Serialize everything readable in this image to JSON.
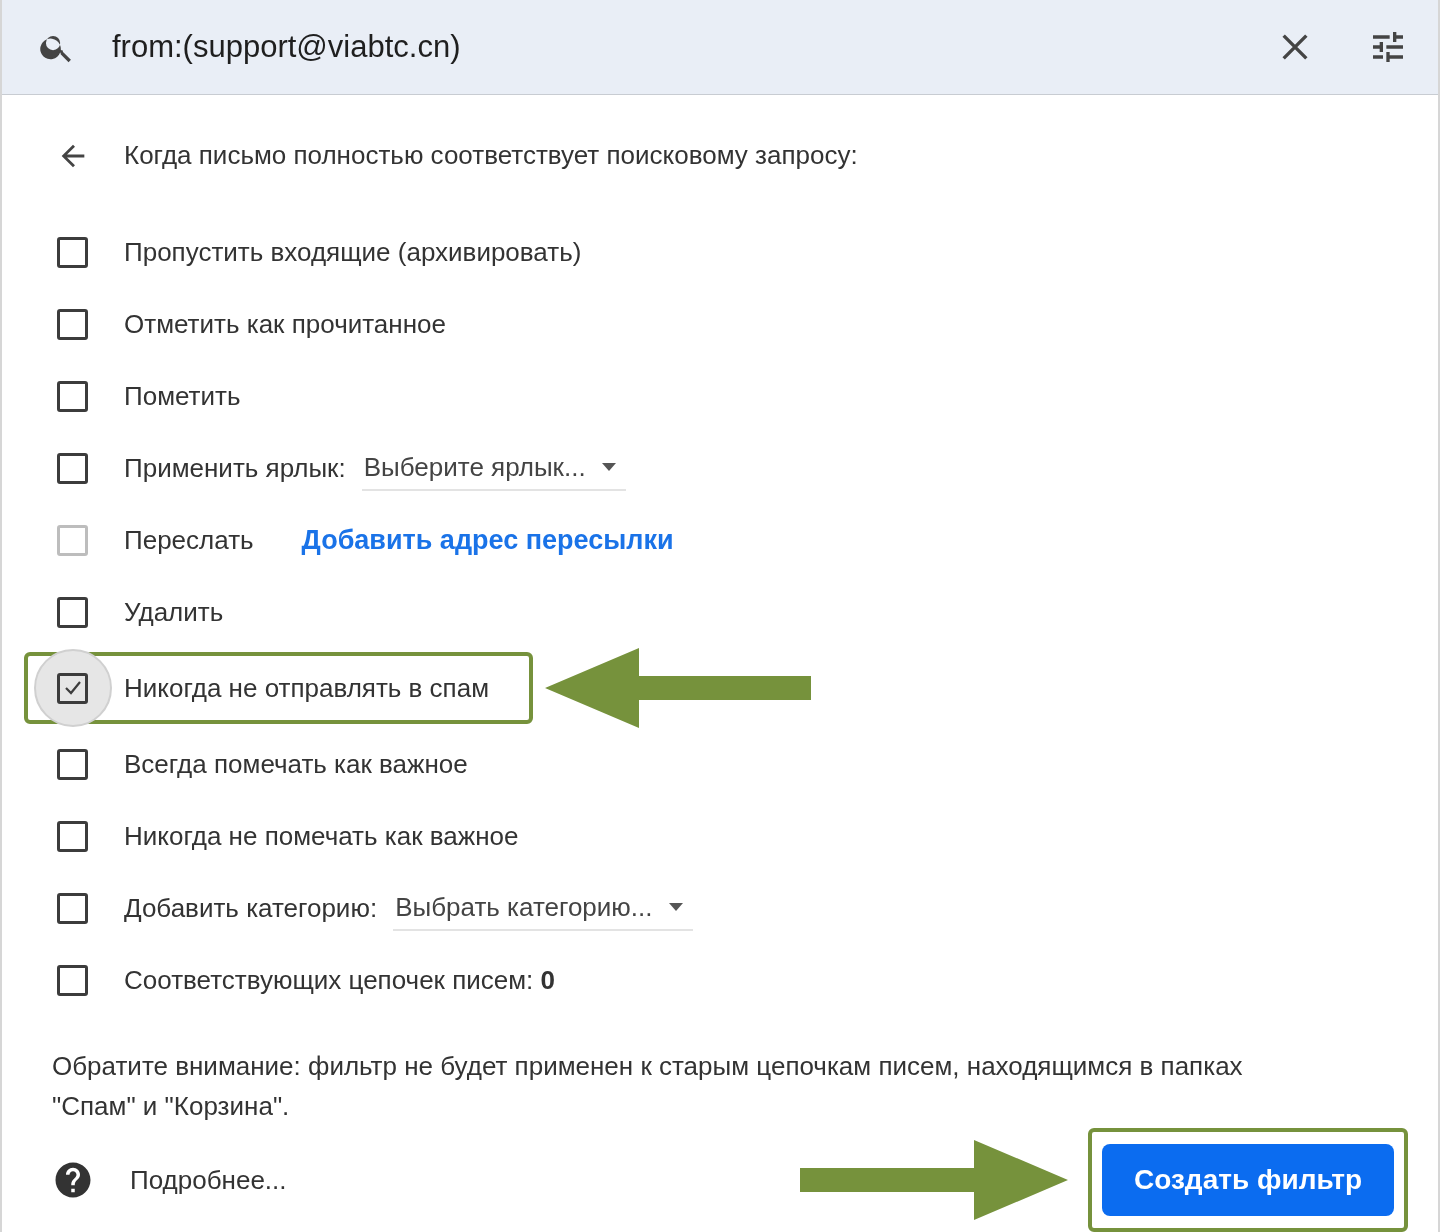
{
  "search": {
    "value": "from:(support@viabtc.cn)"
  },
  "heading": "Когда письмо полностью соответствует поисковому запросу:",
  "options": [
    {
      "kind": "plain",
      "label": "Пропустить входящие (архивировать)",
      "checked": false,
      "disabled": false,
      "highlighted": false
    },
    {
      "kind": "plain",
      "label": "Отметить как прочитанное",
      "checked": false,
      "disabled": false,
      "highlighted": false
    },
    {
      "kind": "plain",
      "label": "Пометить",
      "checked": false,
      "disabled": false,
      "highlighted": false
    },
    {
      "kind": "select",
      "label": "Применить ярлык:",
      "select": "Выберите ярлык...",
      "checked": false,
      "disabled": false,
      "highlighted": false
    },
    {
      "kind": "link",
      "label": "Переслать",
      "link": "Добавить адрес пересылки",
      "checked": false,
      "disabled": true,
      "highlighted": false
    },
    {
      "kind": "plain",
      "label": "Удалить",
      "checked": false,
      "disabled": false,
      "highlighted": false
    },
    {
      "kind": "plain",
      "label": "Никогда не отправлять в спам",
      "checked": true,
      "disabled": false,
      "highlighted": true
    },
    {
      "kind": "plain",
      "label": "Всегда помечать как важное",
      "checked": false,
      "disabled": false,
      "highlighted": false
    },
    {
      "kind": "plain",
      "label": "Никогда не помечать как важное",
      "checked": false,
      "disabled": false,
      "highlighted": false
    },
    {
      "kind": "select",
      "label": "Добавить категорию:",
      "select": "Выбрать категорию...",
      "checked": false,
      "disabled": false,
      "highlighted": false
    },
    {
      "kind": "plain",
      "label": "Соответствующих цепочек писем: **0**",
      "checked": false,
      "disabled": false,
      "highlighted": false
    }
  ],
  "note": "Обратите внимание: фильтр не будет применен к старым цепочкам писем, находящимся в папках \"Спам\" и \"Корзина\".",
  "help_link": "Подробнее...",
  "create_button": {
    "label": "Создать фильтр",
    "highlighted": true
  }
}
